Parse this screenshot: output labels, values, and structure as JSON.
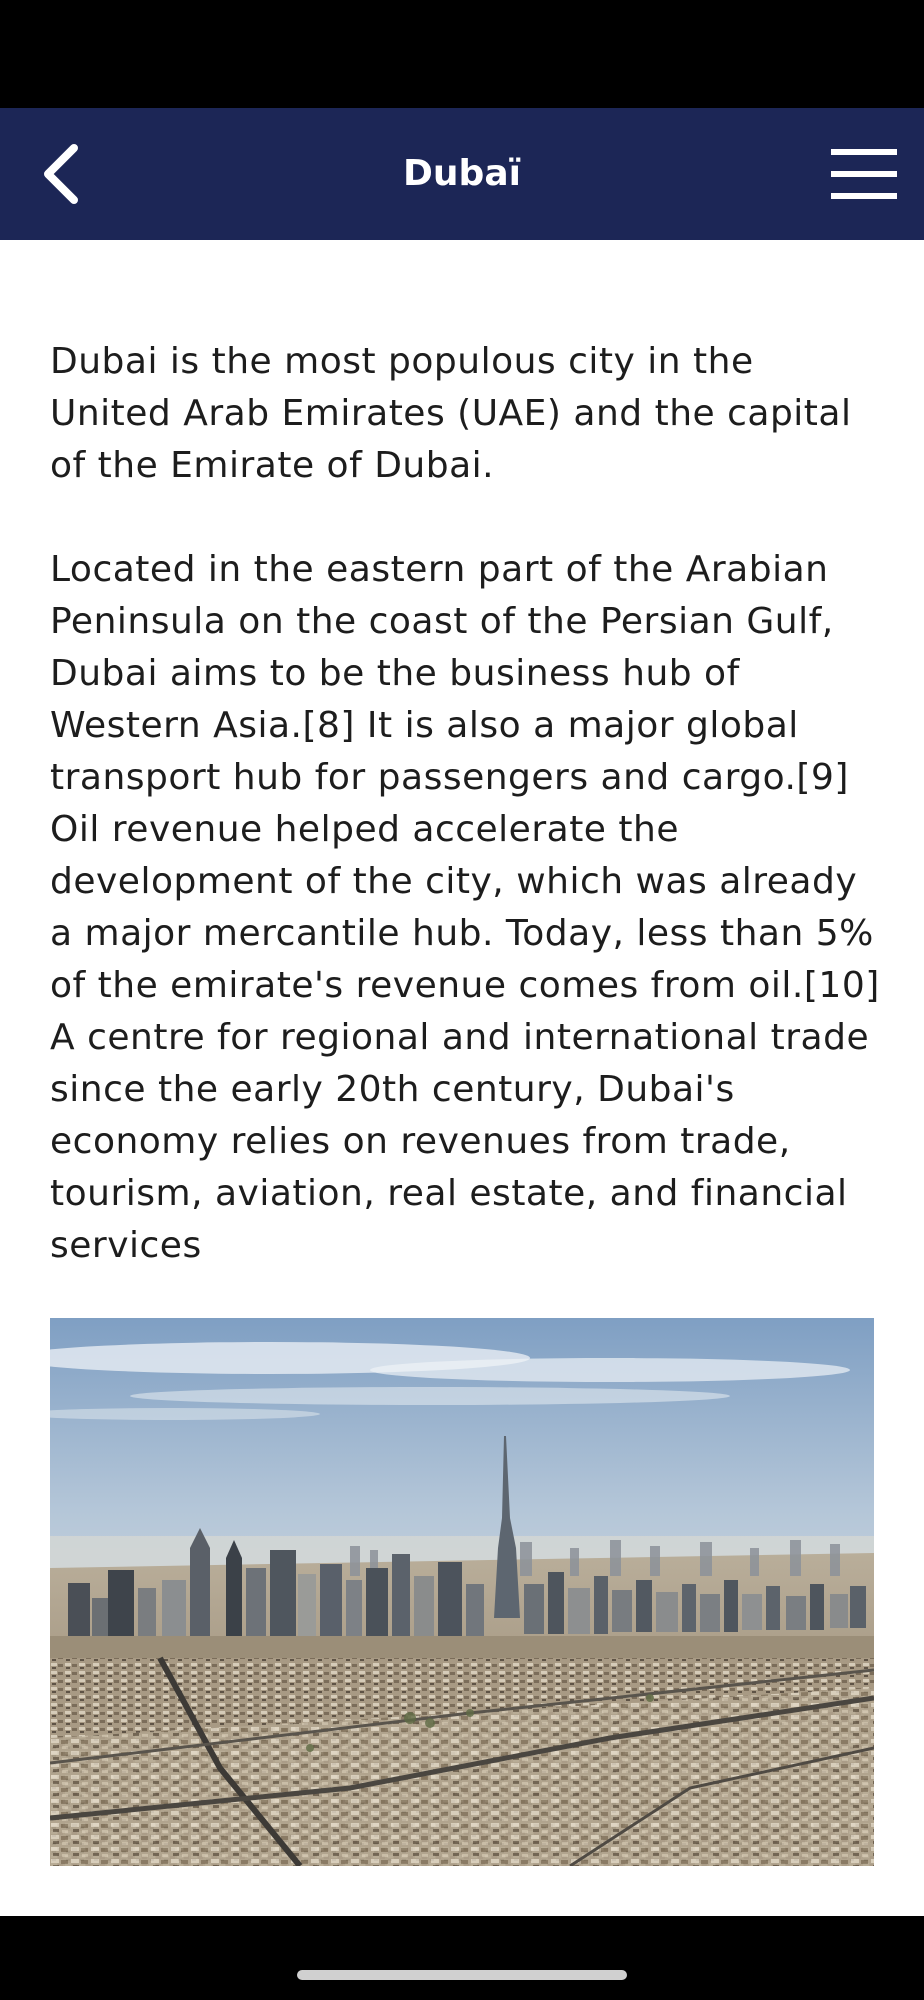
{
  "app": {
    "title": "Dubaï"
  },
  "nav": {
    "back_icon": "chevron-left-icon",
    "menu_icon": "hamburger-menu-icon",
    "background_color": "#1c2656"
  },
  "article": {
    "paragraphs": [
      "Dubai is the most populous city in the United Arab Emirates (UAE) and the capital of the Emirate of Dubai.",
      "Located in the eastern part of the Arabian Peninsula on the coast of the Persian Gulf, Dubai aims to be the business hub of Western Asia.[8] It is also a major global transport hub for passengers and cargo.[9] Oil revenue helped accelerate the development of the city, which was already a major mercantile hub. Today, less than 5% of the emirate's revenue comes from oil.[10] A centre for regional and international trade since the early 20th century, Dubai's economy relies on revenues from trade, tourism, aviation, real estate, and financial services"
    ],
    "image_subject": "aerial-photo-dubai-skyline"
  }
}
